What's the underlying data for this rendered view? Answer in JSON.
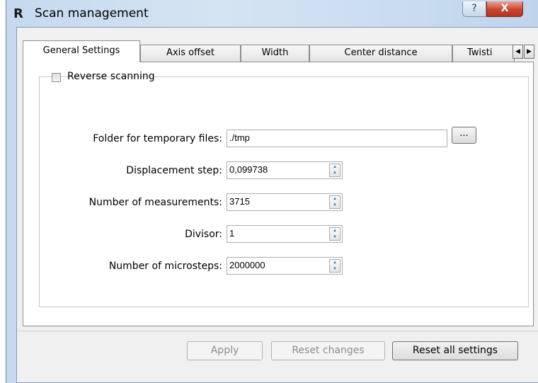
{
  "window": {
    "app_icon": "R",
    "title": "Scan management",
    "help_glyph": "?",
    "close_glyph": "X"
  },
  "tabs": [
    {
      "label": "General Settings",
      "active": true
    },
    {
      "label": "Axis offset",
      "active": false
    },
    {
      "label": "Width",
      "active": false
    },
    {
      "label": "Center distance",
      "active": false
    },
    {
      "label": "Twisti",
      "active": false
    }
  ],
  "tab_scroll": {
    "left": "◀",
    "right": "▶"
  },
  "general": {
    "reverse_scanning": {
      "label": "Reverse scanning",
      "checked": false
    },
    "temp_folder": {
      "label": "Folder for temporary files:",
      "value": "./tmp",
      "browse_label": "..."
    },
    "displacement_step": {
      "label": "Displacement step:",
      "value": "0,099738"
    },
    "num_measurements": {
      "label": "Number of measurements:",
      "value": "3715"
    },
    "divisor": {
      "label": "Divisor:",
      "value": "1"
    },
    "num_microsteps": {
      "label": "Number of microsteps:",
      "value": "2000000"
    }
  },
  "spin": {
    "up": "▲",
    "down": "▼"
  },
  "buttons": {
    "apply": {
      "label": "Apply",
      "enabled": false
    },
    "reset_changes": {
      "label": "Reset changes",
      "enabled": false
    },
    "reset_all": {
      "label": "Reset all settings",
      "enabled": true
    }
  }
}
